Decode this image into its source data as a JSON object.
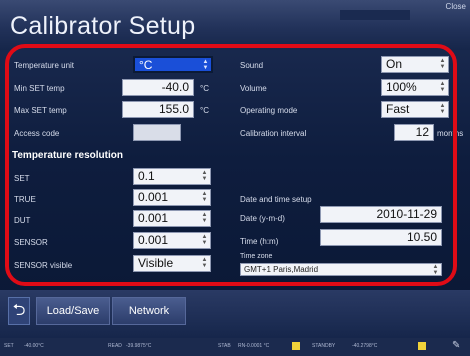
{
  "window": {
    "title": "Calibrator Setup",
    "close_label": "Close"
  },
  "left": {
    "temperature_unit": {
      "label": "Temperature unit",
      "value": "°C"
    },
    "min_set_temp": {
      "label": "Min SET temp",
      "value": "-40.0",
      "unit": "°C"
    },
    "max_set_temp": {
      "label": "Max SET temp",
      "value": "155.0",
      "unit": "°C"
    },
    "access_code": {
      "label": "Access code",
      "value": ""
    },
    "resolution_heading": "Temperature resolution",
    "resolution": [
      {
        "label": "SET",
        "value": "0.1"
      },
      {
        "label": "TRUE",
        "value": "0.001"
      },
      {
        "label": "DUT",
        "value": "0.001"
      },
      {
        "label": "SENSOR",
        "value": "0.001"
      },
      {
        "label": "SENSOR visible",
        "value": "Visible"
      }
    ]
  },
  "right": {
    "sound": {
      "label": "Sound",
      "value": "On"
    },
    "volume": {
      "label": "Volume",
      "value": "100%"
    },
    "operating_mode": {
      "label": "Operating mode",
      "value": "Fast"
    },
    "calibration_interval": {
      "label": "Calibration interval",
      "value": "12",
      "unit": "months"
    },
    "datetime_heading": "Date and time setup",
    "date": {
      "label": "Date (y-m-d)",
      "value": "2010-11-29"
    },
    "time": {
      "label": "Time (h:m)",
      "value": "10.50"
    },
    "timezone": {
      "label": "Time zone",
      "value": "GMT+1 Paris,Madrid"
    }
  },
  "softkeys": {
    "back_icon": "back-arrow-icon",
    "load_save": "Load/Save",
    "network": "Network"
  },
  "status": {
    "items": [
      "SET",
      "-40.00°C",
      "READ",
      "-39.9875°C",
      "STAB",
      "RN-0.0001 °C",
      "STANDBY",
      "-40.2798°C"
    ],
    "indicator_color": "#f0d23a",
    "pen_icon": "pen-icon"
  },
  "colors": {
    "highlight": "#e00b16",
    "selected_field": "#1a4fd8"
  }
}
